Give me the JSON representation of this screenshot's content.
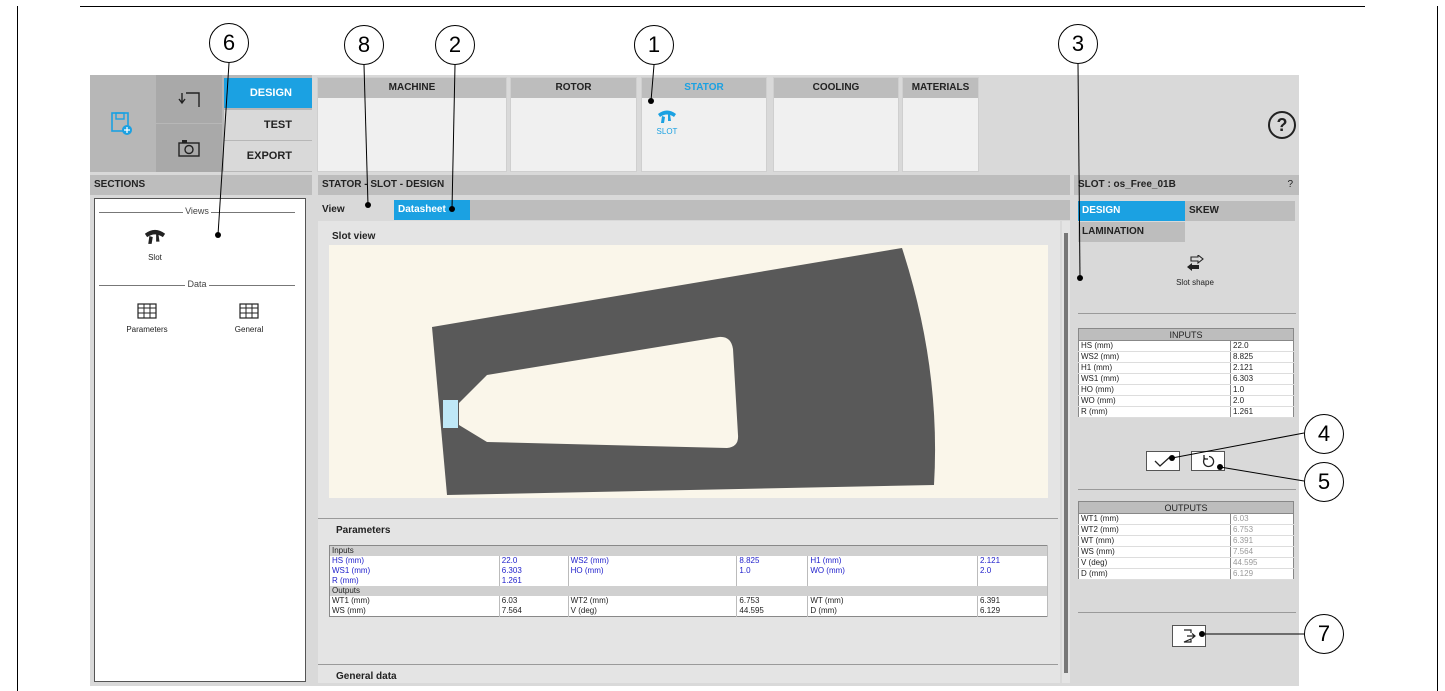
{
  "callouts": [
    "1",
    "2",
    "3",
    "4",
    "5",
    "6",
    "7",
    "8"
  ],
  "toolbar": {
    "nav": [
      "DESIGN",
      "TEST",
      "EXPORT"
    ],
    "modules": [
      {
        "name": "MACHINE",
        "sub": ""
      },
      {
        "name": "ROTOR",
        "sub": ""
      },
      {
        "name": "STATOR",
        "sub": "SLOT"
      },
      {
        "name": "COOLING",
        "sub": ""
      },
      {
        "name": "MATERIALS",
        "sub": ""
      }
    ],
    "help": "?"
  },
  "sections": {
    "title": "SECTIONS",
    "views_label": "Views",
    "data_label": "Data",
    "slot_label": "Slot",
    "parameters_label": "Parameters",
    "general_label": "General"
  },
  "center": {
    "title": "STATOR - SLOT - DESIGN",
    "tab_view": "View",
    "tab_datasheet": "Datasheet",
    "slot_view_title": "Slot view",
    "parameters_title": "Parameters",
    "general_title": "General data",
    "table": {
      "inputs_label": "Inputs",
      "outputs_label": "Outputs",
      "inputs_rows": [
        [
          "HS (mm)",
          "22.0",
          "WS2 (mm)",
          "8.825",
          "H1 (mm)",
          "2.121"
        ],
        [
          "WS1 (mm)",
          "6.303",
          "HO (mm)",
          "1.0",
          "WO (mm)",
          "2.0"
        ],
        [
          "R (mm)",
          "1.261",
          "",
          "",
          "",
          ""
        ]
      ],
      "outputs_rows": [
        [
          "WT1 (mm)",
          "6.03",
          "WT2 (mm)",
          "6.753",
          "WT (mm)",
          "6.391"
        ],
        [
          "WS (mm)",
          "7.564",
          "V (deg)",
          "44.595",
          "D (mm)",
          "6.129"
        ]
      ]
    }
  },
  "right": {
    "title": "SLOT : os_Free_01B",
    "help": "?",
    "tab_design": "DESIGN",
    "tab_skew": "SKEW",
    "tab_lamination": "LAMINATION",
    "slot_shape_label": "Slot shape",
    "inputs_title": "INPUTS",
    "inputs": [
      {
        "k": "HS (mm)",
        "v": "22.0"
      },
      {
        "k": "WS2 (mm)",
        "v": "8.825"
      },
      {
        "k": "H1 (mm)",
        "v": "2.121"
      },
      {
        "k": "WS1 (mm)",
        "v": "6.303"
      },
      {
        "k": "HO (mm)",
        "v": "1.0"
      },
      {
        "k": "WO (mm)",
        "v": "2.0"
      },
      {
        "k": "R (mm)",
        "v": "1.261"
      }
    ],
    "outputs_title": "OUTPUTS",
    "outputs": [
      {
        "k": "WT1 (mm)",
        "v": "6.03"
      },
      {
        "k": "WT2 (mm)",
        "v": "6.753"
      },
      {
        "k": "WT (mm)",
        "v": "6.391"
      },
      {
        "k": "WS (mm)",
        "v": "7.564"
      },
      {
        "k": "V (deg)",
        "v": "44.595"
      },
      {
        "k": "D (mm)",
        "v": "6.129"
      }
    ]
  },
  "colors": {
    "accent": "#1ba1e2",
    "lamination": "#595959",
    "slot": "#faf6ea",
    "opening": "#bfe8f7"
  }
}
